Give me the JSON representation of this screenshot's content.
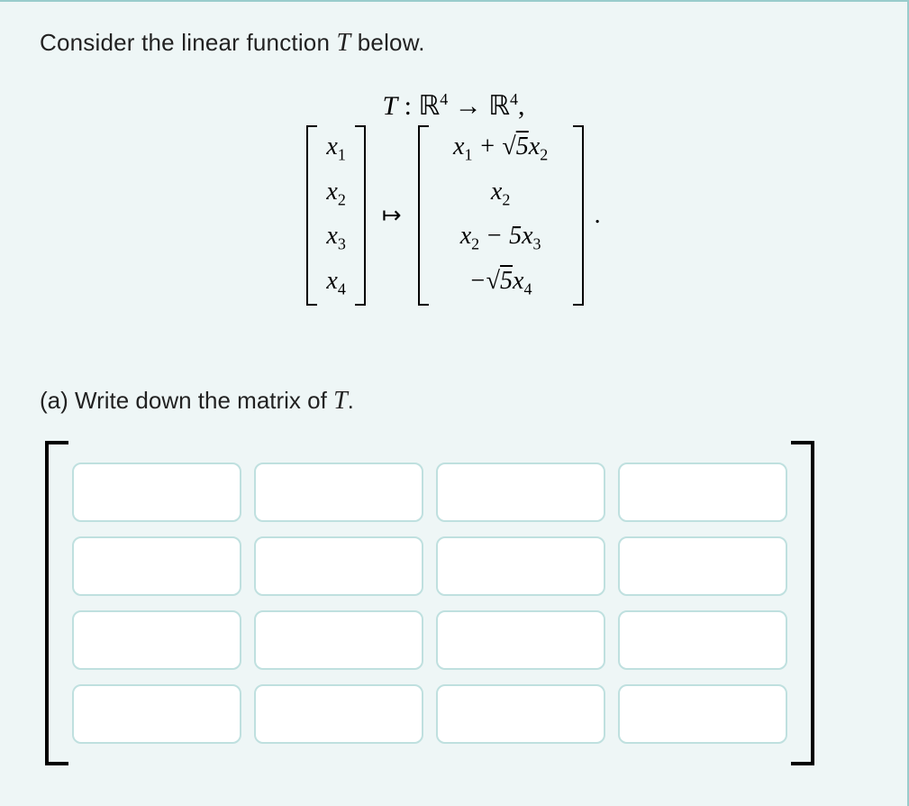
{
  "prompt": {
    "before": "Consider the linear function ",
    "var": "T",
    "after": " below."
  },
  "declaration": {
    "lhs": "T : ℝ",
    "sup1": "4",
    "arrow": " → ℝ",
    "sup2": "4",
    "comma": ","
  },
  "vector_in": [
    "x1",
    "x2",
    "x3",
    "x4"
  ],
  "mapsto": "↦",
  "vector_out": [
    "x1 + √5 x2",
    "x2",
    "x2 − 5x3",
    "−√5 x4"
  ],
  "period": ".",
  "part_a": {
    "label": "(a) Write down the matrix of ",
    "var": "T",
    "period": "."
  },
  "matrix": {
    "rows": 4,
    "cols": 4,
    "values": [
      [
        "",
        "",
        "",
        ""
      ],
      [
        "",
        "",
        "",
        ""
      ],
      [
        "",
        "",
        "",
        ""
      ],
      [
        "",
        "",
        "",
        ""
      ]
    ]
  }
}
